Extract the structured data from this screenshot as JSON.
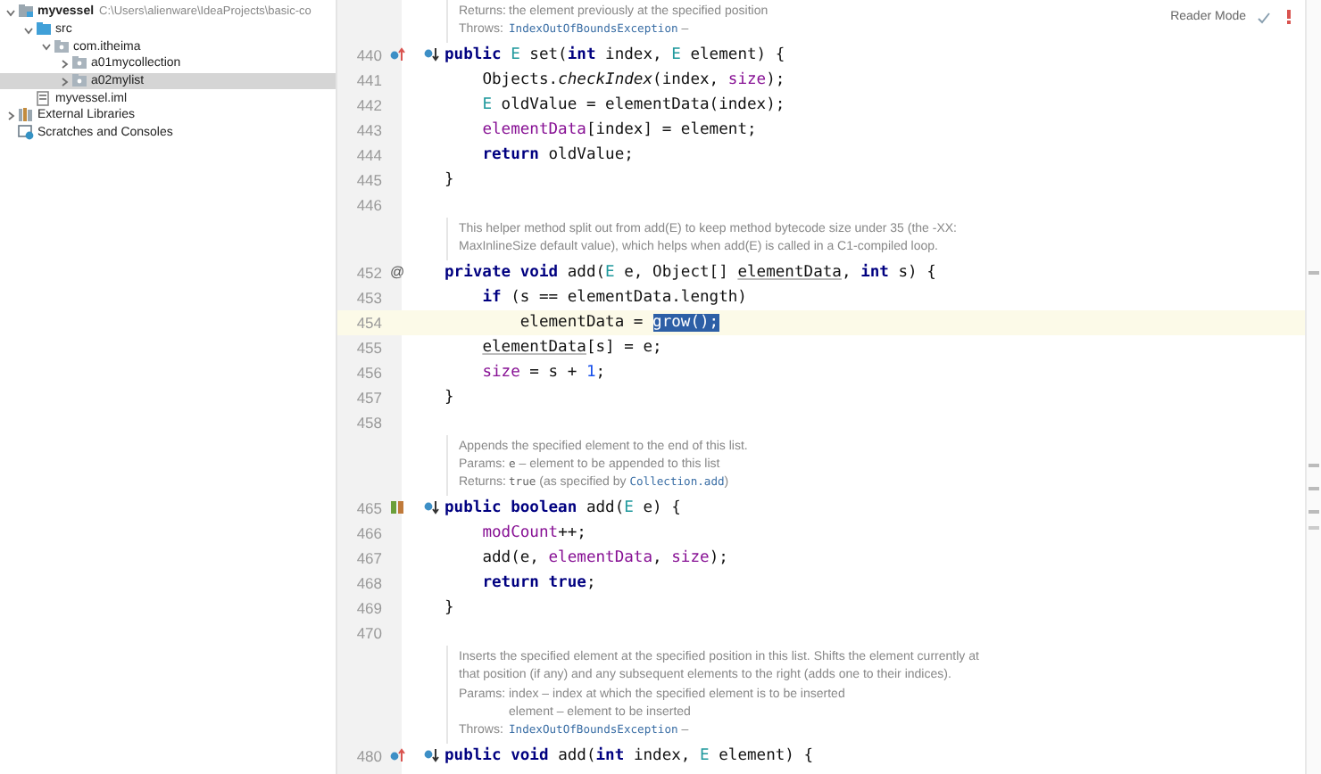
{
  "project_tree": [
    {
      "label": "myvessel",
      "path": "C:\\Users\\alienware\\IdeaProjects\\basic-co",
      "kind": "module",
      "expanded": true,
      "selected": false,
      "children": [
        {
          "label": "src",
          "kind": "folder",
          "expanded": true,
          "selected": false,
          "children": [
            {
              "label": "com.itheima",
              "kind": "package",
              "expanded": true,
              "selected": false,
              "children": [
                {
                  "label": "a01mycollection",
                  "kind": "package",
                  "expanded": false,
                  "selected": false
                },
                {
                  "label": "a02mylist",
                  "kind": "package",
                  "expanded": false,
                  "selected": true
                }
              ]
            }
          ]
        },
        {
          "label": "myvessel.iml",
          "kind": "file",
          "selected": false
        }
      ]
    },
    {
      "label": "External Libraries",
      "kind": "library",
      "expanded": false,
      "selected": false
    },
    {
      "label": "Scratches and Consoles",
      "kind": "scratches",
      "selected": false
    }
  ],
  "editor": {
    "reader_mode": "Reader Mode",
    "blocks": [
      {
        "kind": "doc",
        "lines": [
          {
            "label": "Returns:",
            "parts": [
              {
                "text": "the element previously at the specified position",
                "kind": "text"
              }
            ]
          },
          {
            "label": "Throws:",
            "parts": [
              {
                "text": "IndexOutOfBoundsException",
                "kind": "link"
              },
              {
                "text": " –",
                "kind": "text"
              }
            ]
          }
        ]
      },
      {
        "kind": "code",
        "lines": [
          {
            "number": "440",
            "current": false,
            "markers": [
              {
                "kind": "implements-up"
              },
              {
                "kind": "overridden-down"
              }
            ],
            "tokens": [
              {
                "text": "public ",
                "kind": "kw"
              },
              {
                "text": "E",
                "kind": "type"
              },
              {
                "text": " set(",
                "kind": "plain"
              },
              {
                "text": "int ",
                "kind": "kw"
              },
              {
                "text": "index, ",
                "kind": "plain"
              },
              {
                "text": "E",
                "kind": "type"
              },
              {
                "text": " element) {",
                "kind": "plain"
              }
            ]
          },
          {
            "number": "441",
            "current": false,
            "tokens": [
              {
                "text": "    Objects.",
                "kind": "plain"
              },
              {
                "text": "checkIndex",
                "kind": "italic"
              },
              {
                "text": "(index, ",
                "kind": "plain"
              },
              {
                "text": "size",
                "kind": "field"
              },
              {
                "text": ");",
                "kind": "plain"
              }
            ]
          },
          {
            "number": "442",
            "current": false,
            "tokens": [
              {
                "text": "    E",
                "kind": "type"
              },
              {
                "text": " oldValue = elementData(index);",
                "kind": "plain"
              }
            ]
          },
          {
            "number": "443",
            "current": false,
            "tokens": [
              {
                "text": "    elementData",
                "kind": "field"
              },
              {
                "text": "[index] = element;",
                "kind": "plain"
              }
            ]
          },
          {
            "number": "444",
            "current": false,
            "tokens": [
              {
                "text": "    return ",
                "kind": "kw"
              },
              {
                "text": "oldValue;",
                "kind": "plain"
              }
            ]
          },
          {
            "number": "445",
            "current": false,
            "tokens": [
              {
                "text": "}",
                "kind": "plain"
              }
            ]
          },
          {
            "number": "446",
            "current": false
          }
        ]
      },
      {
        "kind": "doc",
        "lines": [
          {
            "parts": [
              {
                "text": "This helper method split out from add(E) to keep method bytecode size under 35 (the -XX:",
                "kind": "text"
              }
            ]
          },
          {
            "parts": [
              {
                "text": "MaxInlineSize default value), which helps when add(E) is called in a C1-compiled loop.",
                "kind": "text"
              }
            ]
          }
        ]
      },
      {
        "kind": "code",
        "lines": [
          {
            "number": "452",
            "current": false,
            "markers": [
              {
                "kind": "annotation",
                "text": "@"
              }
            ],
            "tokens": [
              {
                "text": "private ",
                "kind": "kw"
              },
              {
                "text": "void ",
                "kind": "kw"
              },
              {
                "text": "add(",
                "kind": "plain"
              },
              {
                "text": "E",
                "kind": "type"
              },
              {
                "text": " e, Object[] ",
                "kind": "plain"
              },
              {
                "text": "elementData",
                "kind": "param"
              },
              {
                "text": ", ",
                "kind": "plain"
              },
              {
                "text": "int ",
                "kind": "kw"
              },
              {
                "text": "s) {",
                "kind": "plain"
              }
            ]
          },
          {
            "number": "453",
            "current": false,
            "tokens": [
              {
                "text": "    if ",
                "kind": "kw"
              },
              {
                "text": "(s == elementData.length)",
                "kind": "plain"
              }
            ]
          },
          {
            "number": "454",
            "current": true,
            "tokens": [
              {
                "text": "        elementData = ",
                "kind": "plain"
              },
              {
                "text": "grow();",
                "kind": "selection"
              }
            ]
          },
          {
            "number": "455",
            "current": false,
            "tokens": [
              {
                "text": "    elementData",
                "kind": "param"
              },
              {
                "text": "[s] = e;",
                "kind": "plain"
              }
            ]
          },
          {
            "number": "456",
            "current": false,
            "tokens": [
              {
                "text": "    size",
                "kind": "field"
              },
              {
                "text": " = s + ",
                "kind": "plain"
              },
              {
                "text": "1",
                "kind": "number"
              },
              {
                "text": ";",
                "kind": "plain"
              }
            ]
          },
          {
            "number": "457",
            "current": false,
            "tokens": [
              {
                "text": "}",
                "kind": "plain"
              }
            ]
          },
          {
            "number": "458",
            "current": false
          }
        ]
      },
      {
        "kind": "doc",
        "lines": [
          {
            "parts": [
              {
                "text": "Appends the specified element to the end of this list.",
                "kind": "text"
              }
            ]
          },
          {
            "label": "Params:",
            "parts": [
              {
                "text": "e",
                "kind": "code"
              },
              {
                "text": " – element to be appended to this list",
                "kind": "text"
              }
            ]
          },
          {
            "label": "Returns:",
            "parts": [
              {
                "text": "true",
                "kind": "code"
              },
              {
                "text": " (as specified by ",
                "kind": "text"
              },
              {
                "text": "Collection.add",
                "kind": "link"
              },
              {
                "text": ")",
                "kind": "text"
              }
            ]
          }
        ]
      },
      {
        "kind": "code",
        "lines": [
          {
            "number": "465",
            "current": false,
            "markers": [
              {
                "kind": "implements-mixed"
              },
              {
                "kind": "overridden-down"
              }
            ],
            "tokens": [
              {
                "text": "public ",
                "kind": "kw"
              },
              {
                "text": "boolean ",
                "kind": "kw"
              },
              {
                "text": "add(",
                "kind": "plain"
              },
              {
                "text": "E",
                "kind": "type"
              },
              {
                "text": " e) {",
                "kind": "plain"
              }
            ]
          },
          {
            "number": "466",
            "current": false,
            "tokens": [
              {
                "text": "    modCount",
                "kind": "field"
              },
              {
                "text": "++;",
                "kind": "plain"
              }
            ]
          },
          {
            "number": "467",
            "current": false,
            "tokens": [
              {
                "text": "    add(e, ",
                "kind": "plain"
              },
              {
                "text": "elementData",
                "kind": "field"
              },
              {
                "text": ", ",
                "kind": "plain"
              },
              {
                "text": "size",
                "kind": "field"
              },
              {
                "text": ");",
                "kind": "plain"
              }
            ]
          },
          {
            "number": "468",
            "current": false,
            "tokens": [
              {
                "text": "    return ",
                "kind": "kw"
              },
              {
                "text": "true",
                "kind": "kw"
              },
              {
                "text": ";",
                "kind": "plain"
              }
            ]
          },
          {
            "number": "469",
            "current": false,
            "tokens": [
              {
                "text": "}",
                "kind": "plain"
              }
            ]
          },
          {
            "number": "470",
            "current": false
          }
        ]
      },
      {
        "kind": "doc",
        "lines": [
          {
            "parts": [
              {
                "text": "Inserts the specified element at the specified position in this list. Shifts the element currently at",
                "kind": "text"
              }
            ]
          },
          {
            "parts": [
              {
                "text": "that position (if any) and any subsequent elements to the right (adds one to their indices).",
                "kind": "text"
              }
            ]
          },
          {
            "label": "Params:",
            "parts": [
              {
                "text": "index – index at which the specified element is to be inserted",
                "kind": "text"
              }
            ]
          },
          {
            "hanging": true,
            "parts": [
              {
                "text": "element – element to be inserted",
                "kind": "text"
              }
            ]
          },
          {
            "label": "Throws:",
            "parts": [
              {
                "text": "IndexOutOfBoundsException",
                "kind": "link"
              },
              {
                "text": " –",
                "kind": "text"
              }
            ]
          }
        ]
      },
      {
        "kind": "code",
        "lines": [
          {
            "number": "480",
            "current": false,
            "markers": [
              {
                "kind": "implements-up"
              },
              {
                "kind": "overridden-down"
              }
            ],
            "tokens": [
              {
                "text": "public ",
                "kind": "kw"
              },
              {
                "text": "void ",
                "kind": "kw"
              },
              {
                "text": "add(",
                "kind": "plain"
              },
              {
                "text": "int ",
                "kind": "kw"
              },
              {
                "text": "index, ",
                "kind": "plain"
              },
              {
                "text": "E",
                "kind": "type"
              },
              {
                "text": " element) {",
                "kind": "plain"
              }
            ]
          }
        ]
      }
    ]
  }
}
